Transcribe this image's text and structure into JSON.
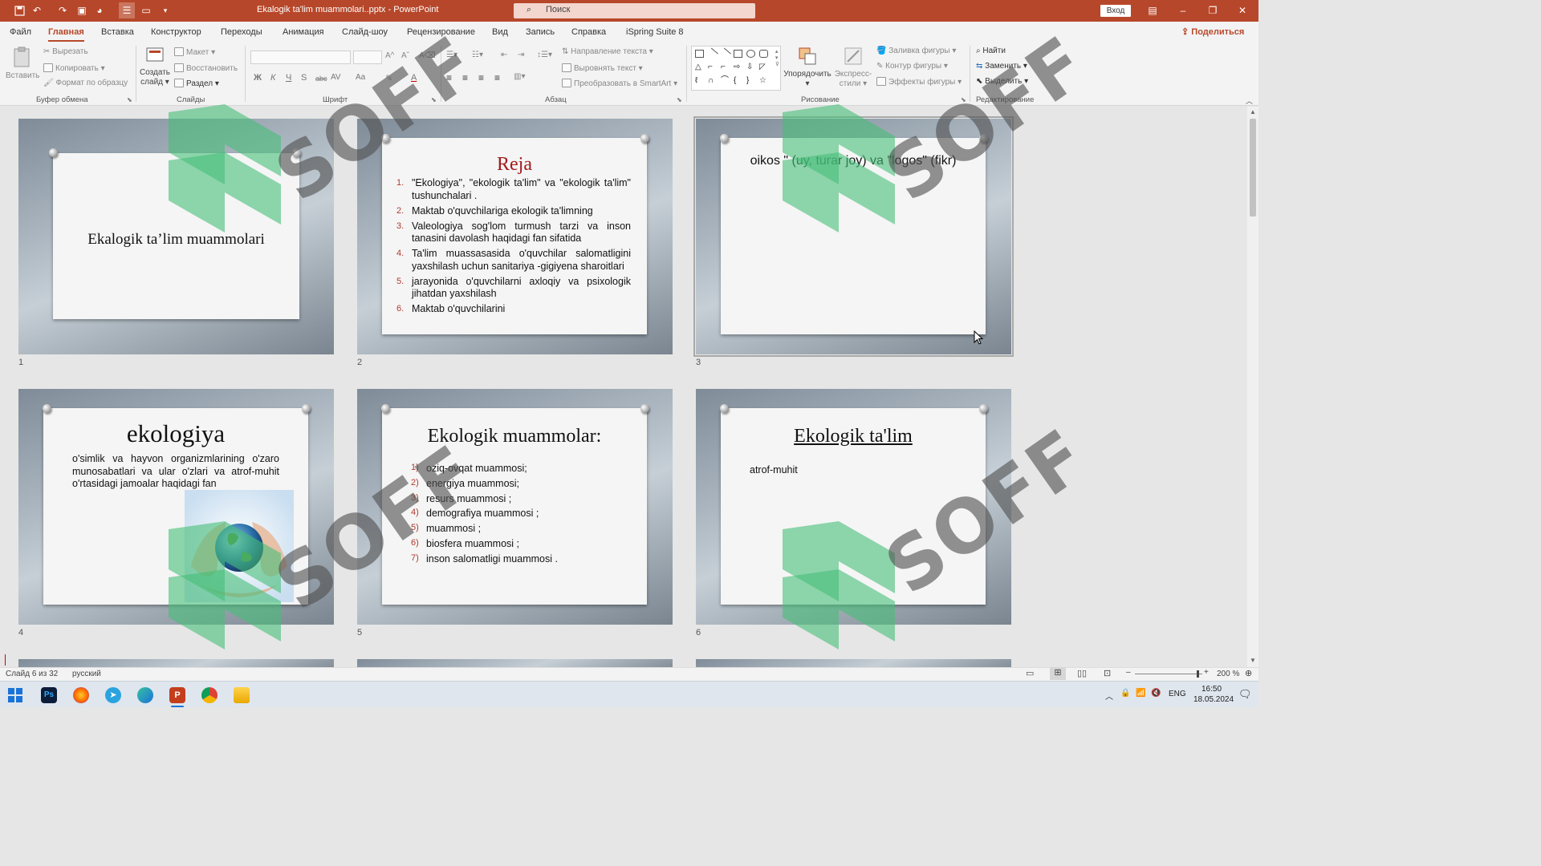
{
  "app": {
    "doc_title": "Ekalogik ta'lim muammolari..pptx - PowerPoint",
    "search_placeholder": "Поиск",
    "signin": "Вход"
  },
  "menu": {
    "tabs": [
      "Файл",
      "Главная",
      "Вставка",
      "Конструктор",
      "Переходы",
      "Анимация",
      "Слайд-шоу",
      "Рецензирование",
      "Вид",
      "Запись",
      "Справка",
      "iSpring Suite 8"
    ],
    "active": "Главная",
    "share": "Поделиться"
  },
  "ribbon": {
    "clipboard": {
      "paste": "Вставить",
      "cut": "Вырезать",
      "copy": "Копировать",
      "format_painter": "Формат по образцу",
      "label": "Буфер обмена"
    },
    "slides": {
      "new_slide": "Создать слайд",
      "layout": "Макет",
      "reset": "Восстановить",
      "section": "Раздел",
      "label": "Слайды"
    },
    "font": {
      "label": "Шрифт",
      "bold": "Ж",
      "italic": "К",
      "underline": "Ч",
      "shadow": "S",
      "strike": "abc",
      "spacing": "AV",
      "case": "Aa"
    },
    "paragraph": {
      "text_direction": "Направление текста",
      "align_text": "Выровнять текст",
      "smartart": "Преобразовать в SmartArt",
      "label": "Абзац"
    },
    "drawing": {
      "arrange": "Упорядочить",
      "quick_styles": "Экспресс-стили",
      "shape_fill": "Заливка фигуры",
      "shape_outline": "Контур фигуры",
      "shape_effects": "Эффекты фигуры",
      "label": "Рисование"
    },
    "editing": {
      "find": "Найти",
      "replace": "Заменить",
      "select": "Выделить",
      "label": "Редактирование"
    }
  },
  "slides": [
    {
      "num": "1",
      "title": "Ekalogik ta’lim muammolari"
    },
    {
      "num": "2",
      "title": "Reja",
      "items": [
        "\"Ekologiya\", \"ekologik ta'lim\" va \"ekologik ta'lim\" tushunchalari .",
        "Maktab o'quvchilariga ekologik ta'limning",
        "Valeologiya sog'lom turmush tarzi va inson tanasini davolash haqidagi fan sifatida",
        "Ta'lim muassasasida o'quvchilar salomatligini yaxshilash uchun sanitariya -gigiyena sharoitlari",
        "jarayonida o'quvchilarni axloqiy va psixologik jihatdan yaxshilash",
        "Maktab o'quvchilarini"
      ]
    },
    {
      "num": "3",
      "text": "oikos \" (uy, turar joy) va \"logos\" (fikr)"
    },
    {
      "num": "4",
      "title": "ekologiya",
      "text": "o'simlik va hayvon organizmlarining o'zaro munosabatlari va ular o'zlari va atrof-muhit o'rtasidagi jamoalar haqidagi fan"
    },
    {
      "num": "5",
      "title": "Ekologik muammolar:",
      "items": [
        "oziq-ovqat muammosi;",
        "energiya muammosi;",
        "resurs muammosi ;",
        "demografiya muammosi ;",
        "muammosi ;",
        "biosfera muammosi ;",
        "inson salomatligi muammosi ."
      ]
    },
    {
      "num": "6",
      "title": "Ekologik ta'lim",
      "text": "atrof-muhit"
    }
  ],
  "list_markers": [
    "1.",
    "2.",
    "3.",
    "4.",
    "5.",
    "6."
  ],
  "list_markers2": [
    "1)",
    "2)",
    "3)",
    "4)",
    "5)",
    "6)",
    "7)"
  ],
  "watermark": "SOFF",
  "status": {
    "slide": "Слайд 6 из 32",
    "lang": "русский",
    "zoom": "200 %"
  },
  "taskbar": {
    "lang": "ENG",
    "time": "16:50",
    "date": "18.05.2024"
  },
  "colors": {
    "brand": "#b7472a",
    "title_red": "#a11a1a",
    "number_red": "#b03a2e"
  }
}
